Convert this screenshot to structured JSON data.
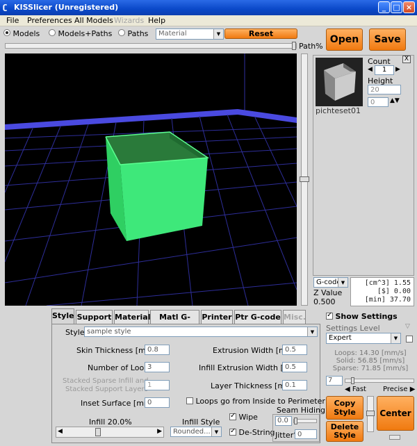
{
  "window": {
    "title": "KISSlicer (Unregistered)"
  },
  "menu": [
    "File",
    "Preferences",
    "All Models",
    "Wizards",
    "Help"
  ],
  "menu_disabled": [
    "Wizards"
  ],
  "view_mode": {
    "options": [
      "Models",
      "Models+Paths",
      "Paths"
    ],
    "selected": "Models",
    "dropdown_value": "Material"
  },
  "toolbar": {
    "reset_label": "Reset",
    "open_label": "Open",
    "save_label": "Save",
    "path_label": "Path%"
  },
  "model_panel": {
    "count_label": "Count",
    "count_value": "1",
    "height_label": "Height",
    "height_value": "20",
    "z_value": "0",
    "model_name": "pichteset01"
  },
  "stats": {
    "mode": "G-code",
    "z_label": "Z Value",
    "z_value": "0.500",
    "cm3": "[cm^3]  1.55",
    "dollar": "[$]  0.00",
    "min": "[min]  37.70"
  },
  "tabs": [
    "Style",
    "Support",
    "Material",
    "Matl G-code",
    "Printer",
    "Ptr G-code",
    "Misc."
  ],
  "active_tab": "Style",
  "style": {
    "style_label": "Style",
    "style_value": "sample style",
    "skin_thickness_label": "Skin Thickness [mm]",
    "skin_thickness": "0.8",
    "loops_label": "Number of Loops",
    "loops": "3",
    "stacked_label_1": "Stacked Sparse Infill and",
    "stacked_label_2": "Stacked Support Layers",
    "stacked": "1",
    "inset_label": "Inset  Surface [mm]",
    "inset": "0",
    "extrusion_width_label": "Extrusion Width [mm]",
    "extrusion_width": "0.5",
    "infill_extrusion_label": "Infill Extrusion Width [mm]",
    "infill_extrusion": "0.5",
    "layer_thickness_label": "Layer Thickness [mm]",
    "layer_thickness": "0.1",
    "loops_inside_label": "Loops go from Inside to Perimeter",
    "infill_label": "Infill  20.0%",
    "infill_style_label": "Infill Style",
    "infill_style": "Rounded...",
    "wipe_label": "Wipe",
    "destring_label": "De-String",
    "seam_label": "Seam Hiding",
    "seam_value": "0.0",
    "jitter_label": "Jitter°",
    "jitter": "0"
  },
  "settings": {
    "show_label": "Show Settings",
    "level_label": "Settings Level",
    "level": "Expert",
    "loops_speed": "Loops:  14.30 [mm/s]",
    "solid_speed": "Solid:  56.85 [mm/s]",
    "sparse_speed": "Sparse: 71.85 [mm/s]",
    "speed_value": "7",
    "fast_label": "Fast",
    "precise_label": "Precise"
  },
  "buttons": {
    "copy_style_1": "Copy",
    "copy_style_2": "Style",
    "delete_style_1": "Delete",
    "delete_style_2": "Style",
    "center": "Center"
  }
}
